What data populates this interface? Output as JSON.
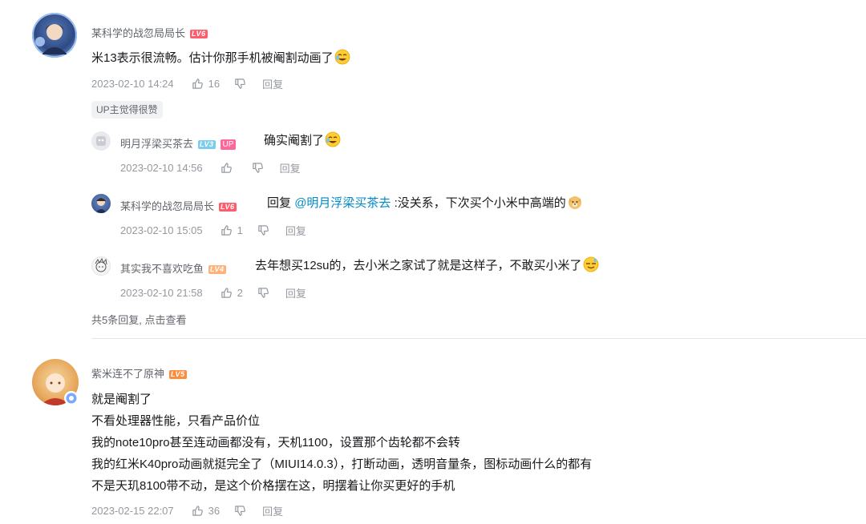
{
  "comments": [
    {
      "username": "某科学的战忽局局长",
      "level": "LV6",
      "content": "米13表示很流畅。估计你那手机被阉割动画了",
      "time": "2023-02-10 14:24",
      "likes": "16",
      "reply_label": "回复",
      "up_liked": "UP主觉得很赞",
      "replies": [
        {
          "username": "明月浮梁买茶去",
          "level": "LV3",
          "badge": "UP",
          "content": "确实阉割了",
          "time": "2023-02-10 14:56",
          "likes": "",
          "reply_label": "回复"
        },
        {
          "username": "某科学的战忽局局长",
          "level": "LV6",
          "reply_prefix": "回复",
          "mention": "@明月浮梁买茶去",
          "content": ":没关系，下次买个小米中高端的",
          "time": "2023-02-10 15:05",
          "likes": "1",
          "reply_label": "回复"
        },
        {
          "username": "其实我不喜欢吃鱼",
          "level": "LV4",
          "content": "去年想买12su的，去小米之家试了就是这样子，不敢买小米了",
          "time": "2023-02-10 21:58",
          "likes": "2",
          "reply_label": "回复"
        }
      ],
      "view_more": "共5条回复, 点击查看"
    },
    {
      "username": "紫米连不了原神",
      "level": "LV5",
      "content_lines": [
        "就是阉割了",
        "不看处理器性能，只看产品价位",
        "我的note10pro甚至连动画都没有，天机1100，设置那个齿轮都不会转",
        "我的红米K40pro动画就挺完全了（MIUI14.0.3），打断动画，透明音量条，图标动画什么的都有",
        "不是天玑8100带不动，是这个价格摆在这，明摆着让你买更好的手机"
      ],
      "time": "2023-02-15 22:07",
      "likes": "36",
      "reply_label": "回复"
    }
  ],
  "colors": {
    "mention": "#008ac5",
    "lv6": "#ff5c6c",
    "lv5": "#ff8b3d",
    "lv3": "#7bcdef",
    "up_badge": "#ff6699",
    "meta_text": "#9499a0"
  }
}
